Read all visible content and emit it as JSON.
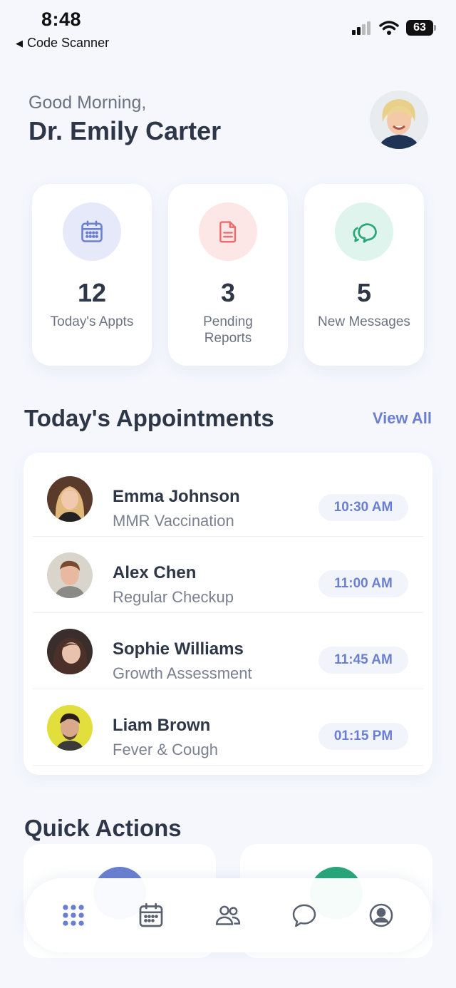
{
  "status": {
    "time": "8:48",
    "back_label": "Code Scanner",
    "battery": "63"
  },
  "header": {
    "greeting": "Good Morning,",
    "doctor_name": "Dr. Emily Carter"
  },
  "stats": [
    {
      "number": "12",
      "label": "Today's Appts",
      "icon": "calendar-icon",
      "color": "#6b7fd1",
      "bg": "#e6e9f9"
    },
    {
      "number": "3",
      "label": "Pending Reports",
      "icon": "document-icon",
      "color": "#ef6b6b",
      "bg": "#fde6e6"
    },
    {
      "number": "5",
      "label": "New Messages",
      "icon": "chat-icon",
      "color": "#27a77a",
      "bg": "#dff4ec"
    }
  ],
  "appointments": {
    "title": "Today's Appointments",
    "view_all": "View All",
    "items": [
      {
        "name": "Emma Johnson",
        "type": "MMR Vaccination",
        "time": "10:30 AM"
      },
      {
        "name": "Alex Chen",
        "type": "Regular Checkup",
        "time": "11:00 AM"
      },
      {
        "name": "Sophie Williams",
        "type": "Growth Assessment",
        "time": "11:45 AM"
      },
      {
        "name": "Liam Brown",
        "type": "Fever & Cough",
        "time": "01:15 PM"
      }
    ]
  },
  "quick_actions": {
    "title": "Quick Actions",
    "colors": [
      "#6b7fd1",
      "#27a77a"
    ]
  },
  "nav": {
    "active_color": "#6b7fd1",
    "inactive_color": "#5a6270",
    "items": [
      "dashboard-icon",
      "calendar-icon",
      "patients-icon",
      "chat-icon",
      "profile-icon"
    ]
  }
}
